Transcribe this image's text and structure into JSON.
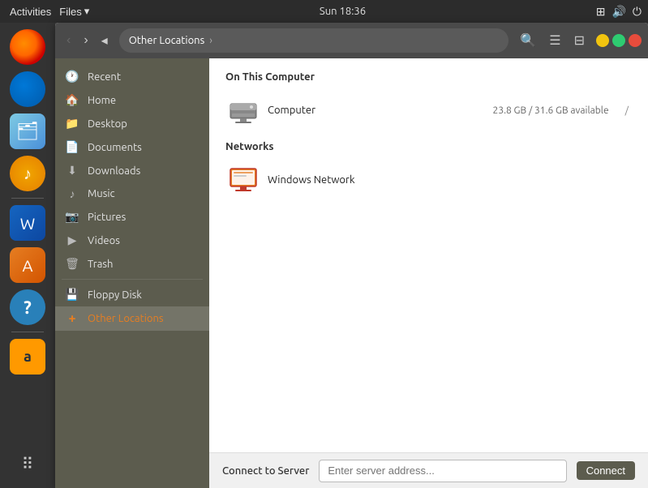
{
  "topbar": {
    "activities": "Activities",
    "files_menu": "Files",
    "files_arrow": "▾",
    "clock": "Sun 18:36"
  },
  "toolbar": {
    "back_label": "‹",
    "forward_label": "›",
    "up_label": "◂",
    "location": "Other Locations",
    "location_arrow": "›",
    "search_icon": "🔍",
    "view_icon_1": "☰",
    "view_icon_2": "⊟"
  },
  "window_controls": {
    "min": "_",
    "max": "□",
    "close": "×"
  },
  "sidebar": {
    "items": [
      {
        "id": "recent",
        "label": "Recent",
        "icon": "🕐"
      },
      {
        "id": "home",
        "label": "Home",
        "icon": "🏠"
      },
      {
        "id": "desktop",
        "label": "Desktop",
        "icon": "📁"
      },
      {
        "id": "documents",
        "label": "Documents",
        "icon": "📄"
      },
      {
        "id": "downloads",
        "label": "Downloads",
        "icon": "⬇"
      },
      {
        "id": "music",
        "label": "Music",
        "icon": "♪"
      },
      {
        "id": "pictures",
        "label": "Pictures",
        "icon": "📷"
      },
      {
        "id": "videos",
        "label": "Videos",
        "icon": "▶"
      },
      {
        "id": "trash",
        "label": "Trash",
        "icon": "🗑"
      },
      {
        "id": "floppy",
        "label": "Floppy Disk",
        "icon": "💾"
      },
      {
        "id": "other",
        "label": "Other Locations",
        "icon": "+"
      }
    ]
  },
  "main": {
    "section_computer": "On This Computer",
    "computer_name": "Computer",
    "computer_info": "23.8 GB / 31.6 GB available",
    "computer_mount": "/",
    "section_network": "Networks",
    "network_name": "Windows Network"
  },
  "bottom": {
    "connect_label": "Connect to Server",
    "input_placeholder": "Enter server address...",
    "connect_btn": "Connect"
  },
  "dock": {
    "items": [
      {
        "id": "firefox",
        "label": "Firefox"
      },
      {
        "id": "thunderbird",
        "label": "Thunderbird"
      },
      {
        "id": "files",
        "label": "Files"
      },
      {
        "id": "rhythmbox",
        "label": "Rhythmbox"
      },
      {
        "id": "libreoffice",
        "label": "LibreOffice Writer"
      },
      {
        "id": "appstore",
        "label": "Ubuntu Software"
      },
      {
        "id": "help",
        "label": "Help"
      },
      {
        "id": "amazon",
        "label": "Amazon"
      },
      {
        "id": "grid",
        "label": "Show Applications"
      }
    ]
  }
}
